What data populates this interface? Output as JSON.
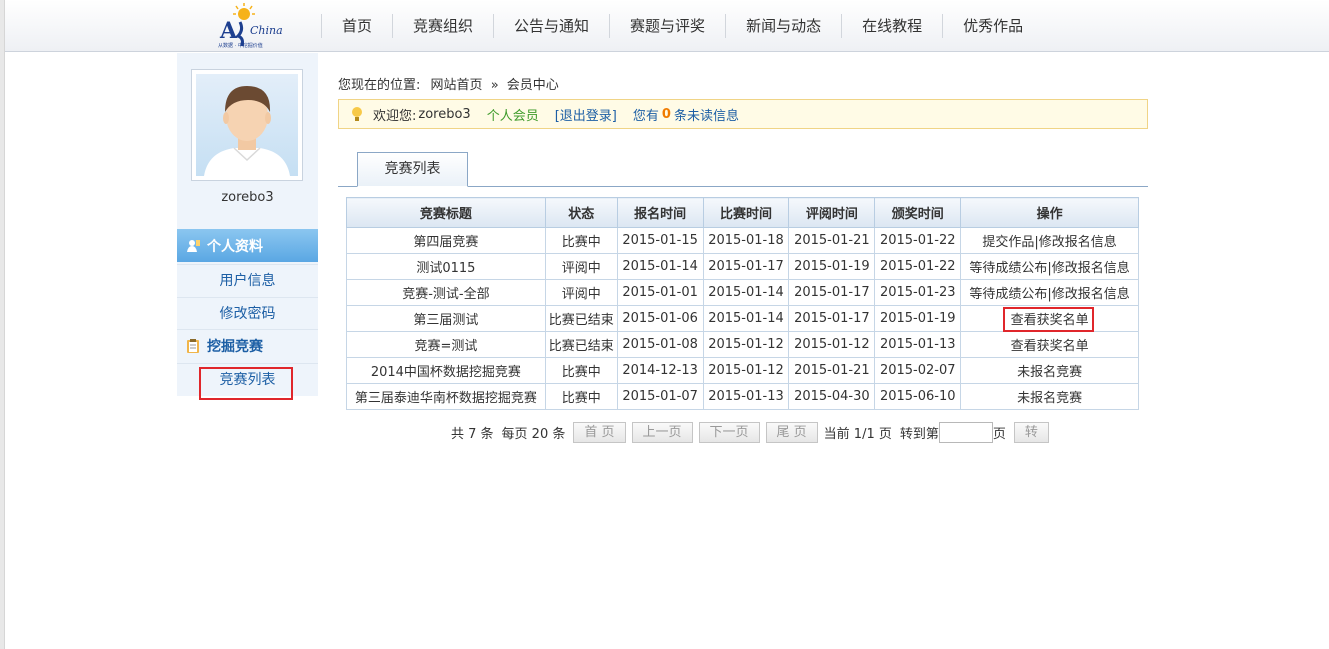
{
  "header": {
    "logo_text": "AI China",
    "nav": [
      "首页",
      "竞赛组织",
      "公告与通知",
      "赛题与评奖",
      "新闻与动态",
      "在线教程",
      "优秀作品"
    ]
  },
  "sidebar": {
    "username": "zorebo3",
    "section1": "个人资料",
    "items1": [
      "用户信息",
      "修改密码"
    ],
    "section2": "挖掘竞赛",
    "items2": [
      "竞赛列表"
    ]
  },
  "breadcrumb": {
    "prefix": "您现在的位置:",
    "home": "网站首页",
    "sep": "»",
    "current": "会员中心"
  },
  "welcome": {
    "greet": "欢迎您:",
    "user": "zorebo3",
    "role": "个人会员",
    "logout": "[退出登录]",
    "msg_prefix": "您有",
    "count": "0",
    "msg_suffix": "条未读信息"
  },
  "tab": {
    "label": "竞赛列表"
  },
  "table": {
    "headers": [
      "竞赛标题",
      "状态",
      "报名时间",
      "比赛时间",
      "评阅时间",
      "颁奖时间",
      "操作"
    ],
    "rows": [
      [
        "第四届竞赛",
        "比赛中",
        "2015-01-15",
        "2015-01-18",
        "2015-01-21",
        "2015-01-22",
        "提交作品|修改报名信息"
      ],
      [
        "测试0115",
        "评阅中",
        "2015-01-14",
        "2015-01-17",
        "2015-01-19",
        "2015-01-22",
        "等待成绩公布|修改报名信息"
      ],
      [
        "竞赛-测试-全部",
        "评阅中",
        "2015-01-01",
        "2015-01-14",
        "2015-01-17",
        "2015-01-23",
        "等待成绩公布|修改报名信息"
      ],
      [
        "第三届测试",
        "比赛已结束",
        "2015-01-06",
        "2015-01-14",
        "2015-01-17",
        "2015-01-19",
        "查看获奖名单"
      ],
      [
        "竞赛=测试",
        "比赛已结束",
        "2015-01-08",
        "2015-01-12",
        "2015-01-12",
        "2015-01-13",
        "查看获奖名单"
      ],
      [
        "2014中国杯数据挖掘竞赛",
        "比赛中",
        "2014-12-13",
        "2015-01-12",
        "2015-01-21",
        "2015-02-07",
        "未报名竞赛"
      ],
      [
        "第三届泰迪华南杯数据挖掘竞赛",
        "比赛中",
        "2015-01-07",
        "2015-01-13",
        "2015-04-30",
        "2015-06-10",
        "未报名竞赛"
      ]
    ]
  },
  "pager": {
    "total": "共 7 条",
    "per_page": "每页 20 条",
    "first": "首 页",
    "prev": "上一页",
    "next": "下一页",
    "last": "尾 页",
    "current": "当前 1/1 页",
    "goto": "转到第",
    "page_unit": "页",
    "go": "转"
  },
  "colors": {
    "accent_blue": "#1d5fa5",
    "highlight_red": "#e0262b",
    "sidebar_active": "#5aa7e3"
  }
}
